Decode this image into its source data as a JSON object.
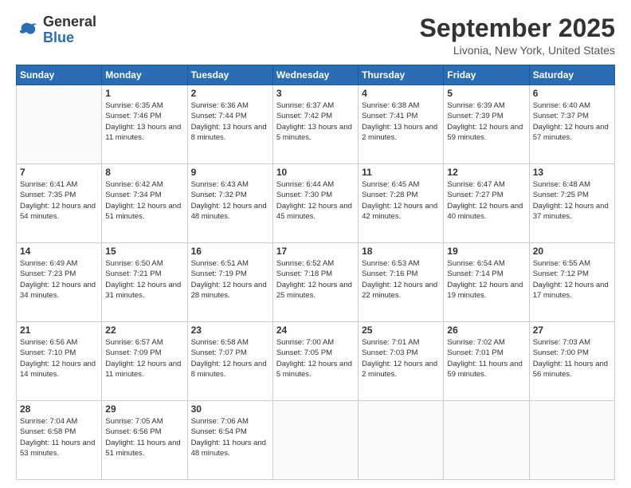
{
  "header": {
    "logo_general": "General",
    "logo_blue": "Blue",
    "month_title": "September 2025",
    "location": "Livonia, New York, United States"
  },
  "weekdays": [
    "Sunday",
    "Monday",
    "Tuesday",
    "Wednesday",
    "Thursday",
    "Friday",
    "Saturday"
  ],
  "weeks": [
    [
      {
        "day": "",
        "sunrise": "",
        "sunset": "",
        "daylight": ""
      },
      {
        "day": "1",
        "sunrise": "Sunrise: 6:35 AM",
        "sunset": "Sunset: 7:46 PM",
        "daylight": "Daylight: 13 hours and 11 minutes."
      },
      {
        "day": "2",
        "sunrise": "Sunrise: 6:36 AM",
        "sunset": "Sunset: 7:44 PM",
        "daylight": "Daylight: 13 hours and 8 minutes."
      },
      {
        "day": "3",
        "sunrise": "Sunrise: 6:37 AM",
        "sunset": "Sunset: 7:42 PM",
        "daylight": "Daylight: 13 hours and 5 minutes."
      },
      {
        "day": "4",
        "sunrise": "Sunrise: 6:38 AM",
        "sunset": "Sunset: 7:41 PM",
        "daylight": "Daylight: 13 hours and 2 minutes."
      },
      {
        "day": "5",
        "sunrise": "Sunrise: 6:39 AM",
        "sunset": "Sunset: 7:39 PM",
        "daylight": "Daylight: 12 hours and 59 minutes."
      },
      {
        "day": "6",
        "sunrise": "Sunrise: 6:40 AM",
        "sunset": "Sunset: 7:37 PM",
        "daylight": "Daylight: 12 hours and 57 minutes."
      }
    ],
    [
      {
        "day": "7",
        "sunrise": "Sunrise: 6:41 AM",
        "sunset": "Sunset: 7:35 PM",
        "daylight": "Daylight: 12 hours and 54 minutes."
      },
      {
        "day": "8",
        "sunrise": "Sunrise: 6:42 AM",
        "sunset": "Sunset: 7:34 PM",
        "daylight": "Daylight: 12 hours and 51 minutes."
      },
      {
        "day": "9",
        "sunrise": "Sunrise: 6:43 AM",
        "sunset": "Sunset: 7:32 PM",
        "daylight": "Daylight: 12 hours and 48 minutes."
      },
      {
        "day": "10",
        "sunrise": "Sunrise: 6:44 AM",
        "sunset": "Sunset: 7:30 PM",
        "daylight": "Daylight: 12 hours and 45 minutes."
      },
      {
        "day": "11",
        "sunrise": "Sunrise: 6:45 AM",
        "sunset": "Sunset: 7:28 PM",
        "daylight": "Daylight: 12 hours and 42 minutes."
      },
      {
        "day": "12",
        "sunrise": "Sunrise: 6:47 AM",
        "sunset": "Sunset: 7:27 PM",
        "daylight": "Daylight: 12 hours and 40 minutes."
      },
      {
        "day": "13",
        "sunrise": "Sunrise: 6:48 AM",
        "sunset": "Sunset: 7:25 PM",
        "daylight": "Daylight: 12 hours and 37 minutes."
      }
    ],
    [
      {
        "day": "14",
        "sunrise": "Sunrise: 6:49 AM",
        "sunset": "Sunset: 7:23 PM",
        "daylight": "Daylight: 12 hours and 34 minutes."
      },
      {
        "day": "15",
        "sunrise": "Sunrise: 6:50 AM",
        "sunset": "Sunset: 7:21 PM",
        "daylight": "Daylight: 12 hours and 31 minutes."
      },
      {
        "day": "16",
        "sunrise": "Sunrise: 6:51 AM",
        "sunset": "Sunset: 7:19 PM",
        "daylight": "Daylight: 12 hours and 28 minutes."
      },
      {
        "day": "17",
        "sunrise": "Sunrise: 6:52 AM",
        "sunset": "Sunset: 7:18 PM",
        "daylight": "Daylight: 12 hours and 25 minutes."
      },
      {
        "day": "18",
        "sunrise": "Sunrise: 6:53 AM",
        "sunset": "Sunset: 7:16 PM",
        "daylight": "Daylight: 12 hours and 22 minutes."
      },
      {
        "day": "19",
        "sunrise": "Sunrise: 6:54 AM",
        "sunset": "Sunset: 7:14 PM",
        "daylight": "Daylight: 12 hours and 19 minutes."
      },
      {
        "day": "20",
        "sunrise": "Sunrise: 6:55 AM",
        "sunset": "Sunset: 7:12 PM",
        "daylight": "Daylight: 12 hours and 17 minutes."
      }
    ],
    [
      {
        "day": "21",
        "sunrise": "Sunrise: 6:56 AM",
        "sunset": "Sunset: 7:10 PM",
        "daylight": "Daylight: 12 hours and 14 minutes."
      },
      {
        "day": "22",
        "sunrise": "Sunrise: 6:57 AM",
        "sunset": "Sunset: 7:09 PM",
        "daylight": "Daylight: 12 hours and 11 minutes."
      },
      {
        "day": "23",
        "sunrise": "Sunrise: 6:58 AM",
        "sunset": "Sunset: 7:07 PM",
        "daylight": "Daylight: 12 hours and 8 minutes."
      },
      {
        "day": "24",
        "sunrise": "Sunrise: 7:00 AM",
        "sunset": "Sunset: 7:05 PM",
        "daylight": "Daylight: 12 hours and 5 minutes."
      },
      {
        "day": "25",
        "sunrise": "Sunrise: 7:01 AM",
        "sunset": "Sunset: 7:03 PM",
        "daylight": "Daylight: 12 hours and 2 minutes."
      },
      {
        "day": "26",
        "sunrise": "Sunrise: 7:02 AM",
        "sunset": "Sunset: 7:01 PM",
        "daylight": "Daylight: 11 hours and 59 minutes."
      },
      {
        "day": "27",
        "sunrise": "Sunrise: 7:03 AM",
        "sunset": "Sunset: 7:00 PM",
        "daylight": "Daylight: 11 hours and 56 minutes."
      }
    ],
    [
      {
        "day": "28",
        "sunrise": "Sunrise: 7:04 AM",
        "sunset": "Sunset: 6:58 PM",
        "daylight": "Daylight: 11 hours and 53 minutes."
      },
      {
        "day": "29",
        "sunrise": "Sunrise: 7:05 AM",
        "sunset": "Sunset: 6:56 PM",
        "daylight": "Daylight: 11 hours and 51 minutes."
      },
      {
        "day": "30",
        "sunrise": "Sunrise: 7:06 AM",
        "sunset": "Sunset: 6:54 PM",
        "daylight": "Daylight: 11 hours and 48 minutes."
      },
      {
        "day": "",
        "sunrise": "",
        "sunset": "",
        "daylight": ""
      },
      {
        "day": "",
        "sunrise": "",
        "sunset": "",
        "daylight": ""
      },
      {
        "day": "",
        "sunrise": "",
        "sunset": "",
        "daylight": ""
      },
      {
        "day": "",
        "sunrise": "",
        "sunset": "",
        "daylight": ""
      }
    ]
  ]
}
